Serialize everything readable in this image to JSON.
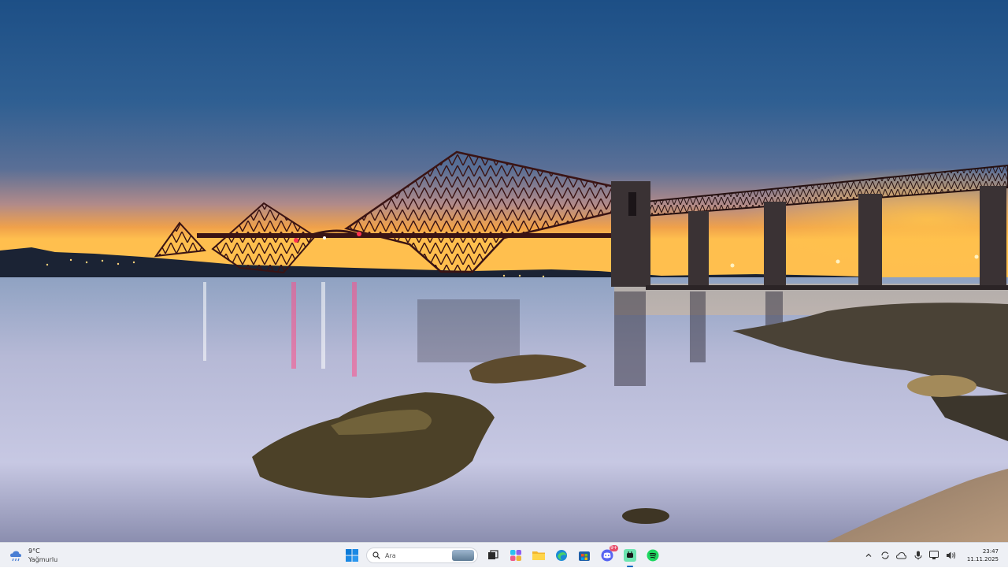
{
  "desktop": {
    "wallpaper": "Forth Bridge at dusk"
  },
  "taskbar": {
    "weather": {
      "temperature": "9°C",
      "condition": "Yağmurlu",
      "icon": "rain-cloud-icon"
    },
    "search": {
      "placeholder": "Ara",
      "icon": "search-icon"
    },
    "apps": [
      {
        "name": "start",
        "icon": "windows-logo-icon"
      },
      {
        "name": "task-view",
        "icon": "task-view-icon"
      },
      {
        "name": "copilot",
        "icon": "copilot-icon"
      },
      {
        "name": "file-explorer",
        "icon": "folder-icon"
      },
      {
        "name": "edge",
        "icon": "edge-icon"
      },
      {
        "name": "microsoft-store",
        "icon": "store-icon"
      },
      {
        "name": "discord",
        "icon": "discord-icon",
        "badge": "9+"
      },
      {
        "name": "chat-app",
        "icon": "chat-app-icon"
      },
      {
        "name": "spotify",
        "icon": "spotify-icon"
      }
    ],
    "tray": {
      "icons": [
        "chevron-up-icon",
        "sync-icon",
        "cloud-icon",
        "microphone-icon",
        "network-icon",
        "volume-icon"
      ],
      "time": "23:47",
      "date": "11.11.2025"
    },
    "colors": {
      "background": "#eef0f5",
      "accent": "#0067c0"
    }
  }
}
